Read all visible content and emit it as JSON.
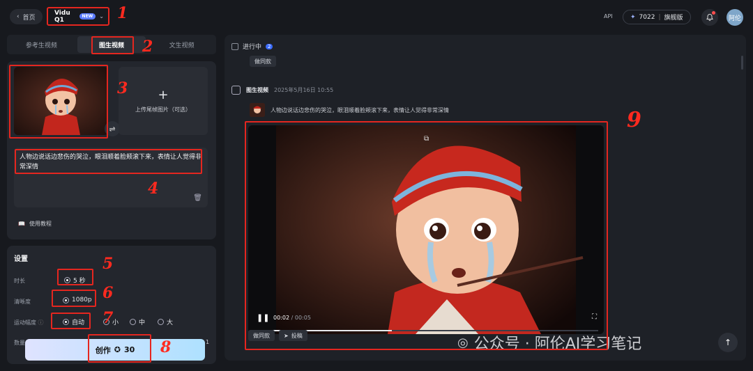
{
  "header": {
    "back_label": "首页",
    "model_name": "Vidu Q1",
    "model_badge": "NEW",
    "api_label": "API",
    "credits_value": "7022",
    "plan_label": "旗舰版",
    "avatar_text": "阿伦"
  },
  "tabs": [
    {
      "label": "参考生视频"
    },
    {
      "label": "图生视频"
    },
    {
      "label": "文生视频"
    }
  ],
  "upload": {
    "end_frame_label": "上传尾帧图片（可选）",
    "prompt_text": "人物边说话边悲伤的哭泣，眼泪顺着脸颊滚下来，表情让人觉得非常深情",
    "tutorial_label": "使用教程"
  },
  "settings": {
    "title": "设置",
    "duration_label": "时长",
    "duration_value": "5 秒",
    "resolution_label": "清晰度",
    "resolution_value": "1080p",
    "motion_label": "运动幅度",
    "motion_options": [
      "自动",
      "小",
      "中",
      "大"
    ],
    "quantity_label": "数量",
    "quantity_value": "1"
  },
  "create_button": {
    "label": "创作",
    "cost": "30"
  },
  "results": {
    "in_progress_label": "进行中",
    "in_progress_count": "2",
    "same_style_label": "做同款",
    "gen_type": "图生视频",
    "gen_date": "2025年5月16日 10:55",
    "prompt_text": "人物边说话边悲伤的哭泣，眼泪顺着脸颊滚下来，表情让人觉得非常深情",
    "video_current": "00:02",
    "video_total": "00:05",
    "video_progress": 0.4,
    "action_same": "做同款",
    "action_post": "投稿"
  },
  "annotations": [
    "1",
    "2",
    "3",
    "4",
    "5",
    "6",
    "7",
    "8",
    "9"
  ],
  "watermark": "公众号 · 阿伦AI学习笔记",
  "colors": {
    "accent_red": "#e5261f",
    "background": "#17191e",
    "panel": "#23262d",
    "button_gradient_start": "#dfe3ff",
    "button_gradient_end": "#aee1ff"
  }
}
